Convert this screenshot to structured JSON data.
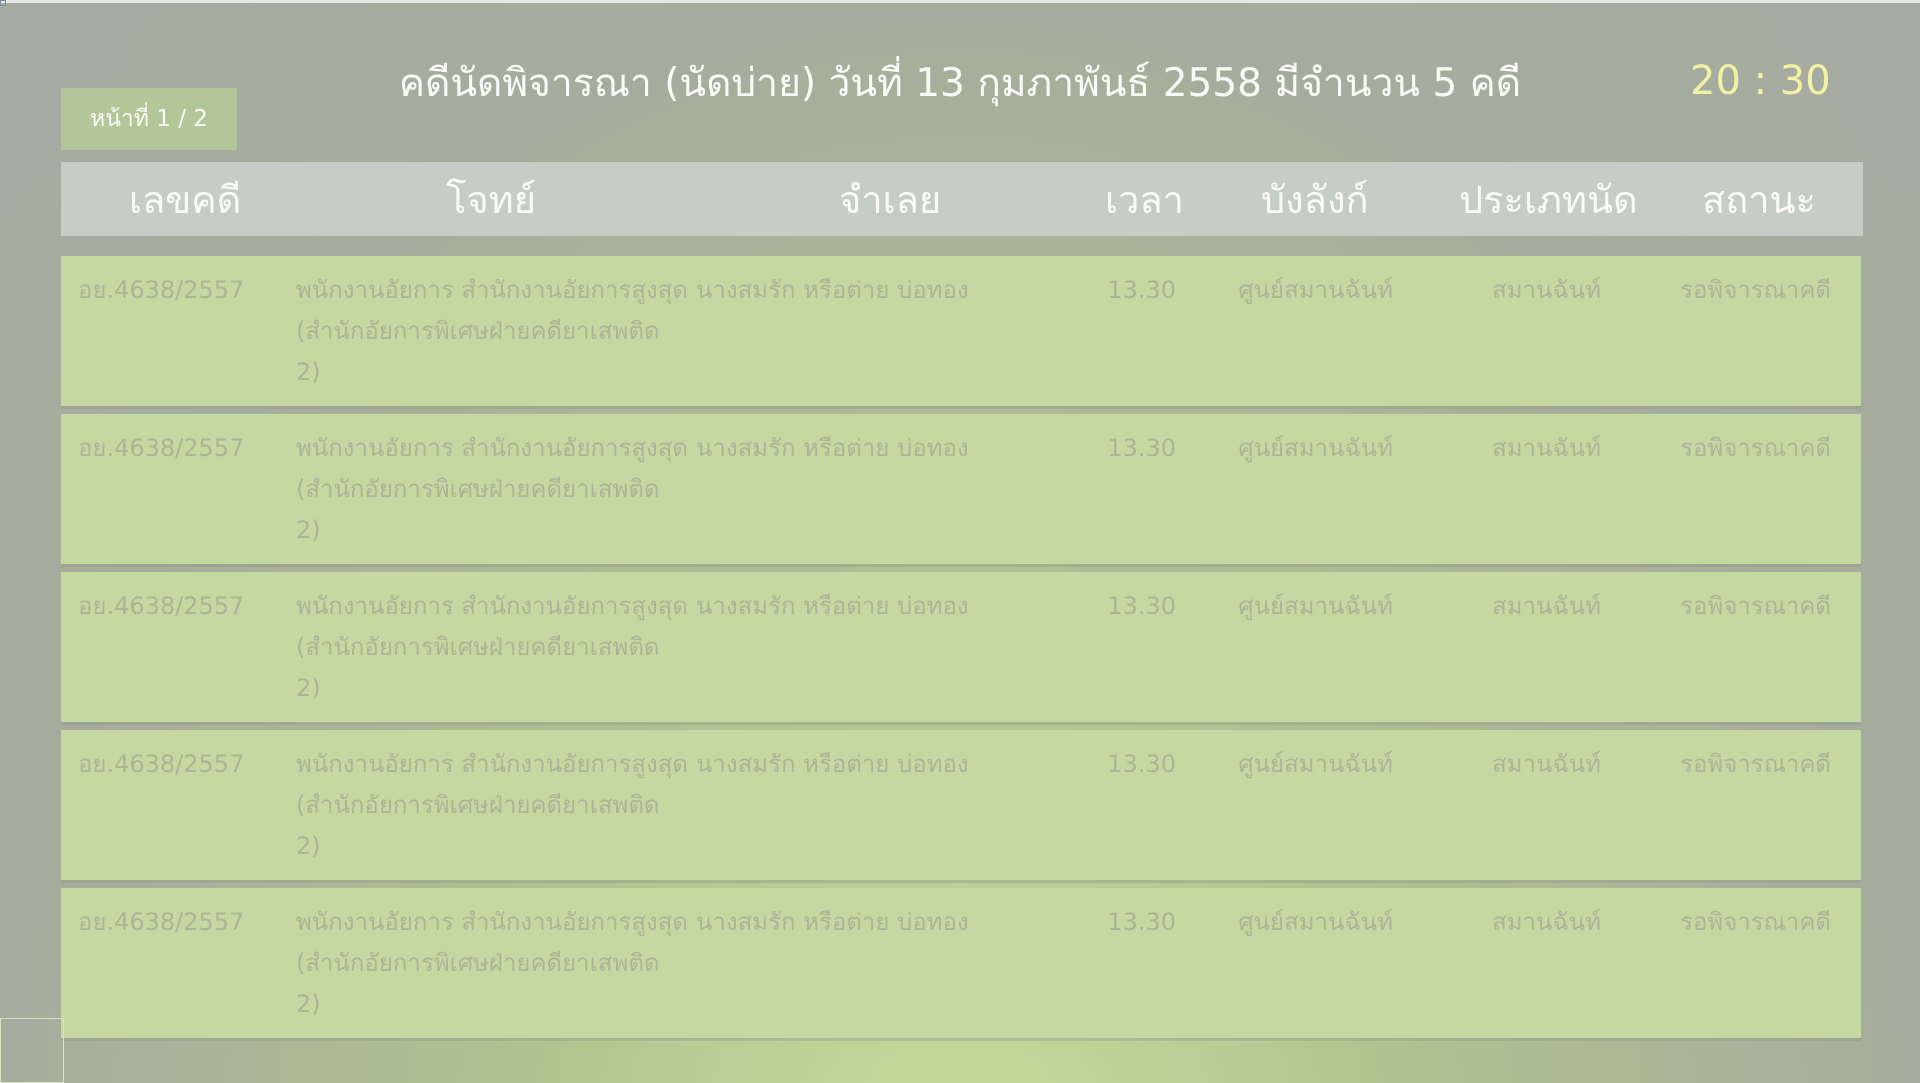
{
  "title": "คดีนัดพิจารณา (นัดบ่าย) วันที่ 13 กุมภาพันธ์ 2558 มีจำนวน 5 คดี",
  "clock": "20 : 30",
  "page_badge": "หน้าที่ 1 / 2",
  "columns": {
    "case_no": "เลขคดี",
    "plaintiff": "โจทย์",
    "defendant": "จำเลย",
    "time": "เวลา",
    "room": "บังลังก์",
    "type": "ประเภทนัด",
    "status": "สถานะ"
  },
  "rows": [
    {
      "case_no": "อย.4638/2557",
      "plaintiff": "พนักงานอัยการ สำนักงานอัยการสูงสุด (สำนักอัยการพิเศษฝ่ายคดียาเสพติด 2)",
      "defendant": "นางสมรัก หรือต่าย บ่อทอง",
      "time": "13.30",
      "room": "ศูนย์สมานฉันท์",
      "type": "สมานฉันท์",
      "status": "รอพิจารณาคดี"
    },
    {
      "case_no": "อย.4638/2557",
      "plaintiff": "พนักงานอัยการ สำนักงานอัยการสูงสุด (สำนักอัยการพิเศษฝ่ายคดียาเสพติด 2)",
      "defendant": "นางสมรัก หรือต่าย บ่อทอง",
      "time": "13.30",
      "room": "ศูนย์สมานฉันท์",
      "type": "สมานฉันท์",
      "status": "รอพิจารณาคดี"
    },
    {
      "case_no": "อย.4638/2557",
      "plaintiff": "พนักงานอัยการ สำนักงานอัยการสูงสุด (สำนักอัยการพิเศษฝ่ายคดียาเสพติด 2)",
      "defendant": "นางสมรัก หรือต่าย บ่อทอง",
      "time": "13.30",
      "room": "ศูนย์สมานฉันท์",
      "type": "สมานฉันท์",
      "status": "รอพิจารณาคดี"
    },
    {
      "case_no": "อย.4638/2557",
      "plaintiff": "พนักงานอัยการ สำนักงานอัยการสูงสุด (สำนักอัยการพิเศษฝ่ายคดียาเสพติด 2)",
      "defendant": "นางสมรัก หรือต่าย บ่อทอง",
      "time": "13.30",
      "room": "ศูนย์สมานฉันท์",
      "type": "สมานฉันท์",
      "status": "รอพิจารณาคดี"
    },
    {
      "case_no": "อย.4638/2557",
      "plaintiff": "พนักงานอัยการ สำนักงานอัยการสูงสุด (สำนักอัยการพิเศษฝ่ายคดียาเสพติด 2)",
      "defendant": "นางสมรัก หรือต่าย บ่อทอง",
      "time": "13.30",
      "room": "ศูนย์สมานฉันท์",
      "type": "สมานฉันท์",
      "status": "รอพิจารณาคดี"
    }
  ]
}
